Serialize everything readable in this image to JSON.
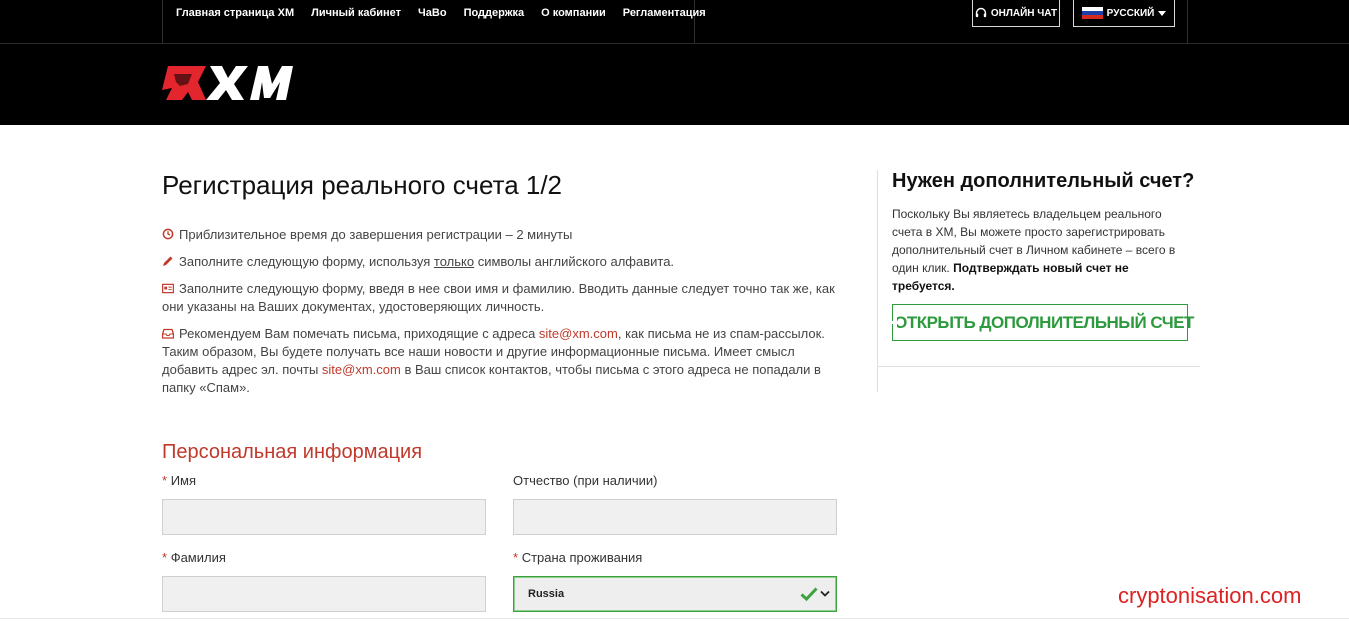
{
  "topnav": {
    "items": [
      "Главная страница XM",
      "Личный кабинет",
      "ЧаВо",
      "Поддержка",
      "О компании",
      "Регламентация"
    ],
    "chat_label": "ОНЛАЙН ЧАТ",
    "language_label": "РУССКИЙ",
    "chat_icon": "headset-icon",
    "language_icon": "russia-flag-icon"
  },
  "brand": {
    "logo_text": "XM",
    "logo_icon": "xm-logo-icon",
    "logo_color": "#e3262e"
  },
  "main": {
    "title": "Регистрация реального счета 1/2",
    "info": [
      {
        "icon": "clock-icon",
        "text": "Приблизительное время до завершения регистрации – 2 минуты"
      },
      {
        "icon": "pencil-icon",
        "text_before": "Заполните следующую форму, используя ",
        "underlined": "только",
        "text_after": " символы английского алфавита."
      },
      {
        "icon": "id-card-icon",
        "text": "Заполните следующую форму, введя в нее свои имя и фамилию. Вводить данные следует точно так же, как они указаны на Ваших документах, удостоверяющих личность."
      },
      {
        "icon": "inbox-icon",
        "p1": "Рекомендуем Вам помечать письма, приходящие с адреса ",
        "email": "site@xm.com",
        "p2": ", как письма не из спам-рассылок. Таким образом, Вы будете получать все наши новости и другие информационные письма. Имеет смысл добавить адрес эл. почты ",
        "p3": " в Ваш список контактов, чтобы письма с этого адреса не попадали в папку «Спам»."
      }
    ]
  },
  "form": {
    "section_title": "Персональная информация",
    "required_mark": "*",
    "first_name_label": "Имя",
    "middle_name_label": "Отчество (при наличии)",
    "last_name_label": "Фамилия",
    "country_label": "Страна проживания",
    "first_name_value": "",
    "middle_name_value": "",
    "last_name_value": "",
    "country_value": "Russia",
    "valid_color": "#3da23d"
  },
  "sidebar": {
    "title": "Нужен дополнительный счет?",
    "text": "Поскольку Вы являетесь владельцем реального счета в XM, Вы можете просто зарегистрировать дополнительный счет в Личном кабинете – всего в один клик. ",
    "bold_text": "Подтверждать новый счет не требуется.",
    "button_label": "ОТКРЫТЬ ДОПОЛНИТЕЛЬНЫЙ СЧЕТ",
    "button_color": "#2e9a3e"
  },
  "watermark": "cryptonisation.com"
}
